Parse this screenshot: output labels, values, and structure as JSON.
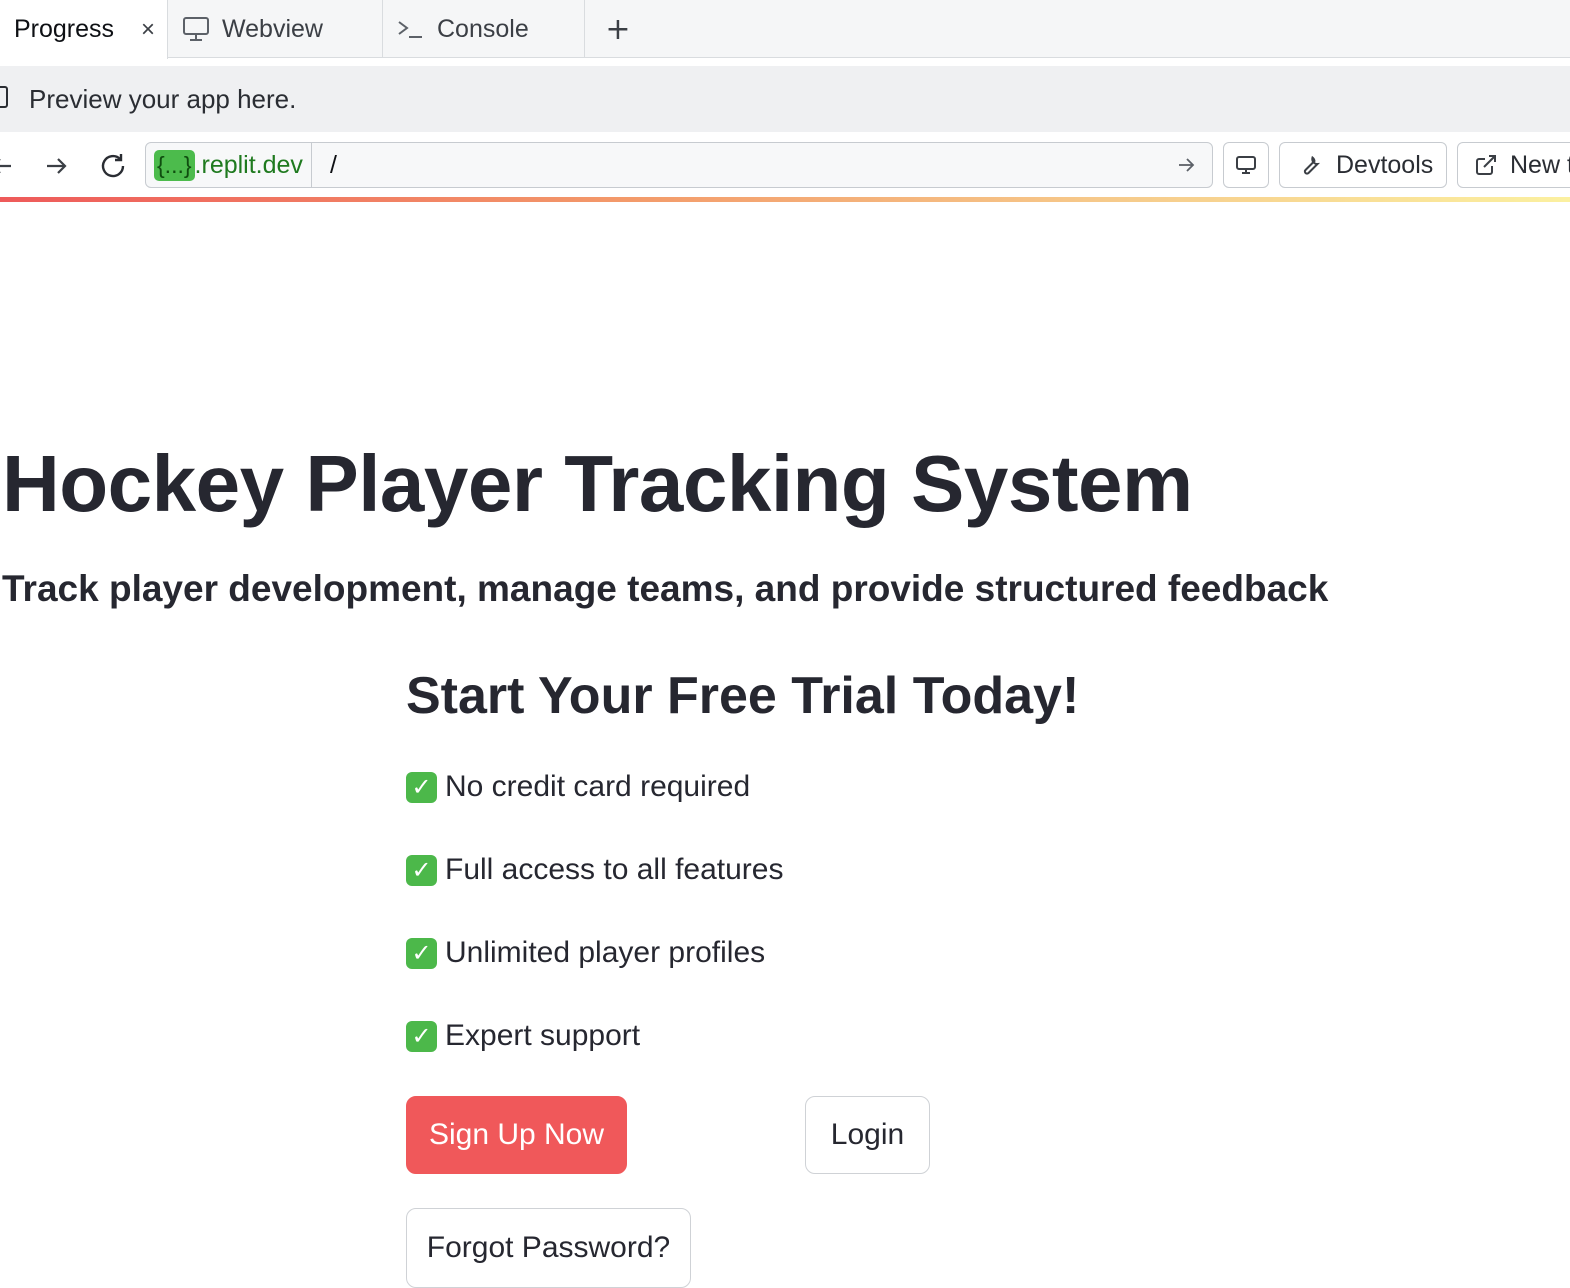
{
  "tabs": [
    {
      "label": "Progress",
      "icon": "list-icon",
      "active": true,
      "close": "×"
    },
    {
      "label": "Webview",
      "icon": "monitor-icon",
      "active": false
    },
    {
      "label": "Console",
      "icon": "terminal-icon",
      "active": false
    }
  ],
  "add_tab_label": "+",
  "banner": {
    "text": "Preview your app here."
  },
  "urlbar": {
    "domain_chip": "{...}",
    "domain_suffix": ".replit.dev",
    "path": "/"
  },
  "toolbar": {
    "devtools_label": "Devtools",
    "new_tab_label": "New tab"
  },
  "app": {
    "title": "Hockey Player Tracking System",
    "subtitle": "Track player development, manage teams, and provide structured feedback",
    "cta_title": "Start Your Free Trial Today!",
    "features": [
      "No credit card required",
      "Full access to all features",
      "Unlimited player profiles",
      "Expert support"
    ],
    "check_glyph": "✓",
    "signup_label": "Sign Up Now",
    "login_label": "Login",
    "forgot_label": "Forgot Password?"
  },
  "colors": {
    "primary": "#f0585a",
    "check_green": "#4cb84a",
    "domain_green": "#4cbb4c"
  }
}
